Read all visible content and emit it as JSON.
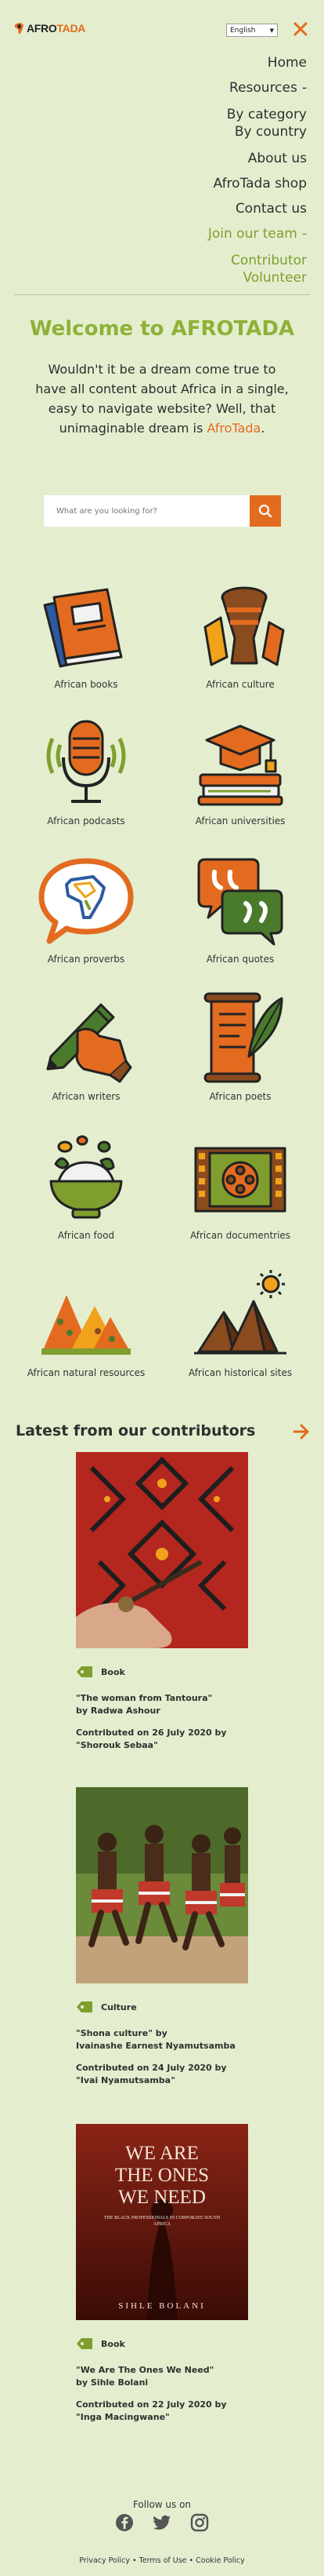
{
  "header": {
    "logo_afro": "AFRO",
    "logo_tada": "TADA",
    "language": "English"
  },
  "menu": {
    "items": [
      {
        "label": "Home"
      },
      {
        "label": "Resources"
      },
      {
        "label": "By category"
      },
      {
        "label": "By country"
      },
      {
        "label": "About us"
      },
      {
        "label": "AfroTada shop"
      },
      {
        "label": "Contact us"
      },
      {
        "label": "Join our team"
      },
      {
        "label": "Contributor"
      },
      {
        "label": "Volunteer"
      }
    ],
    "dash": "-"
  },
  "welcome": {
    "title": "Welcome to AFROTADA",
    "text": "Wouldn't it be a dream come true to have all content about Africa in a single, easy to navigate website? Well, that unimaginable dream is",
    "highlight": "AfroTada",
    "end": "."
  },
  "search": {
    "placeholder": "What are you looking for?"
  },
  "categories": [
    {
      "label": "African books",
      "icon": "books-icon"
    },
    {
      "label": "African culture",
      "icon": "drum-icon"
    },
    {
      "label": "African podcasts",
      "icon": "microphone-icon"
    },
    {
      "label": "African universities",
      "icon": "graduation-cap-icon"
    },
    {
      "label": "African proverbs",
      "icon": "africa-speech-bubble-icon"
    },
    {
      "label": "African quotes",
      "icon": "quotes-icon"
    },
    {
      "label": "African writers",
      "icon": "pen-hand-icon"
    },
    {
      "label": "African poets",
      "icon": "scroll-feather-icon"
    },
    {
      "label": "African food",
      "icon": "food-bowl-icon"
    },
    {
      "label": "African documentries",
      "icon": "film-reel-icon"
    },
    {
      "label": "African natural resources",
      "icon": "minerals-icon"
    },
    {
      "label": "African historical sites",
      "icon": "pyramids-icon"
    }
  ],
  "latest": {
    "title": "Latest from our contributors",
    "posts": [
      {
        "category": "Book",
        "title_line1": "\"The woman from Tantoura\"",
        "title_line2": "by Radwa Ashour",
        "contrib_line1": "Contributed on 26 July 2020 by",
        "contrib_line2": "\"Shorouk Sebaa\""
      },
      {
        "category": "Culture",
        "title_line1": "\"Shona culture\" by",
        "title_line2": "Ivainashe Earnest Nyamutsamba",
        "contrib_line1": "Contributed on 24 July 2020 by",
        "contrib_line2": "\"Ivai Nyamutsamba\""
      },
      {
        "category": "Book",
        "title_line1": "\"We Are The Ones We Need\"",
        "title_line2": "by Sihle Bolani",
        "contrib_line1": "Contributed on 22 July 2020 by",
        "contrib_line2": "\"Inga Macingwane\"",
        "cover_line1": "WE ARE",
        "cover_line2": "THE ONES",
        "cover_line3": "WE NEED",
        "cover_subtitle": "THE BLACK PROFESSIONALS IN CORPORATE SOUTH AFRICA",
        "cover_author": "SIHLE BOLANI"
      }
    ]
  },
  "footer": {
    "follow": "Follow us on",
    "links": "Privacy Policy • Terms of Use • Cookie Policy"
  },
  "colors": {
    "background": "#e4eecf",
    "accent_orange": "#e36b1f",
    "accent_green": "#8fb137"
  }
}
